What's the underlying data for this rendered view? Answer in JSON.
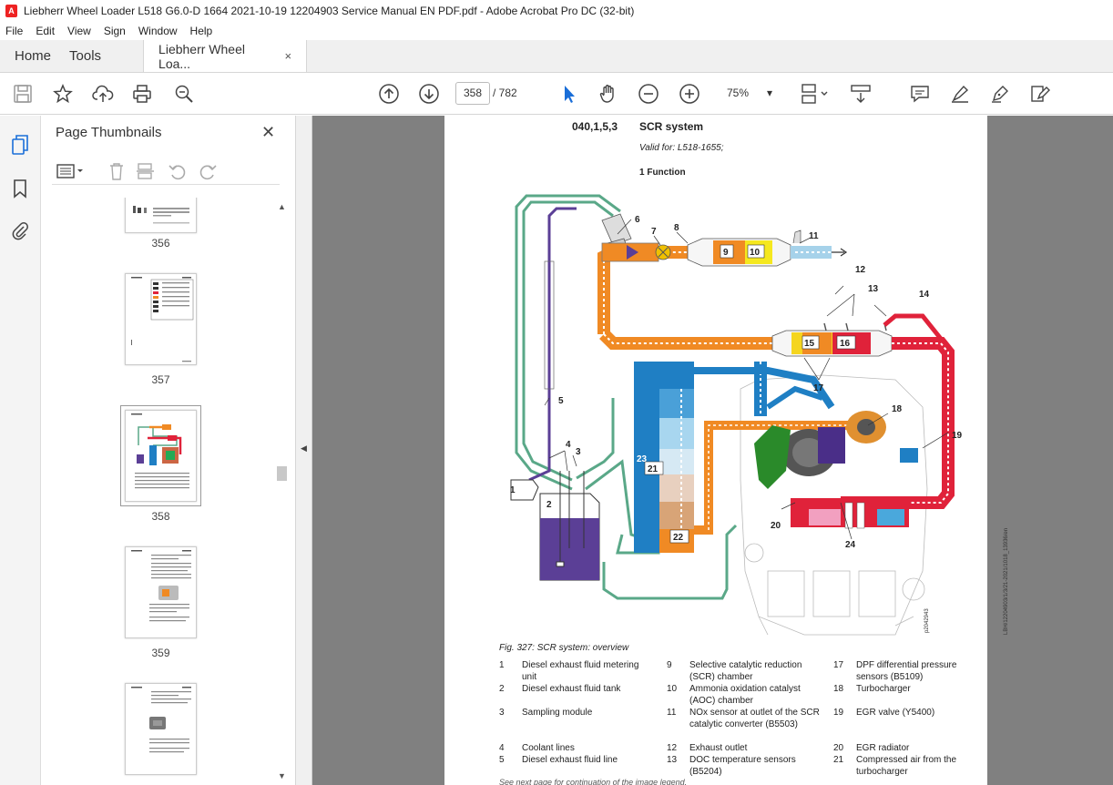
{
  "window": {
    "title": "Liebherr Wheel Loader L518 G6.0-D 1664 2021-10-19 12204903 Service Manual EN PDF.pdf - Adobe Acrobat Pro DC (32-bit)"
  },
  "menu": [
    "File",
    "Edit",
    "View",
    "Sign",
    "Window",
    "Help"
  ],
  "tabs": {
    "home": "Home",
    "tools": "Tools",
    "document": "Liebherr Wheel Loa...",
    "close": "×"
  },
  "toolbar": {
    "page_current": "358",
    "page_total": "/ 782",
    "zoom": "75%"
  },
  "panel": {
    "title": "Page Thumbnails",
    "thumbnails": [
      {
        "label": "356"
      },
      {
        "label": "357"
      },
      {
        "label": "358"
      },
      {
        "label": "359"
      },
      {
        "label": ""
      }
    ]
  },
  "document": {
    "section_number": "040,1,5,3",
    "section_title": "SCR system",
    "valid_for": "Valid for: L518-1655;",
    "function_heading": "1 Function",
    "figure_caption": "Fig. 327: SCR system: overview",
    "figure_code": "LBH/12204903/1/3/21-2021/1018_13936/en",
    "figure_id": "p2042943",
    "continue_note": "See next page for continuation of the image legend.",
    "diagram_labels": [
      "1",
      "2",
      "3",
      "4",
      "5",
      "6",
      "7",
      "8",
      "9",
      "10",
      "11",
      "12",
      "13",
      "14",
      "15",
      "16",
      "17",
      "18",
      "19",
      "20",
      "21",
      "22",
      "23",
      "24"
    ],
    "legend": [
      {
        "num": "1",
        "text": "Diesel exhaust fluid metering unit"
      },
      {
        "num": "2",
        "text": "Diesel exhaust fluid tank"
      },
      {
        "num": "3",
        "text": "Sampling module"
      },
      {
        "num": "4",
        "text": "Coolant lines"
      },
      {
        "num": "5",
        "text": "Diesel exhaust fluid line"
      },
      {
        "num": "9",
        "text": "Selective catalytic reduction (SCR) chamber"
      },
      {
        "num": "10",
        "text": "Ammonia oxidation catalyst (AOC) chamber"
      },
      {
        "num": "11",
        "text": "NOx sensor at outlet of the SCR catalytic converter (B5503)"
      },
      {
        "num": "12",
        "text": "Exhaust outlet"
      },
      {
        "num": "13",
        "text": "DOC temperature sensors (B5204)"
      },
      {
        "num": "17",
        "text": "DPF differential pressure sensors (B5109)"
      },
      {
        "num": "18",
        "text": "Turbocharger"
      },
      {
        "num": "19",
        "text": "EGR valve (Y5400)"
      },
      {
        "num": "20",
        "text": "EGR radiator"
      },
      {
        "num": "21",
        "text": "Compressed air from the turbocharger"
      }
    ]
  },
  "colors": {
    "exhaust_orange": "#f08a24",
    "exhaust_red": "#e0223a",
    "coolant_green": "#5aa888",
    "def_purple": "#5b3f96",
    "cooler_blue": "#1f7fc4"
  }
}
